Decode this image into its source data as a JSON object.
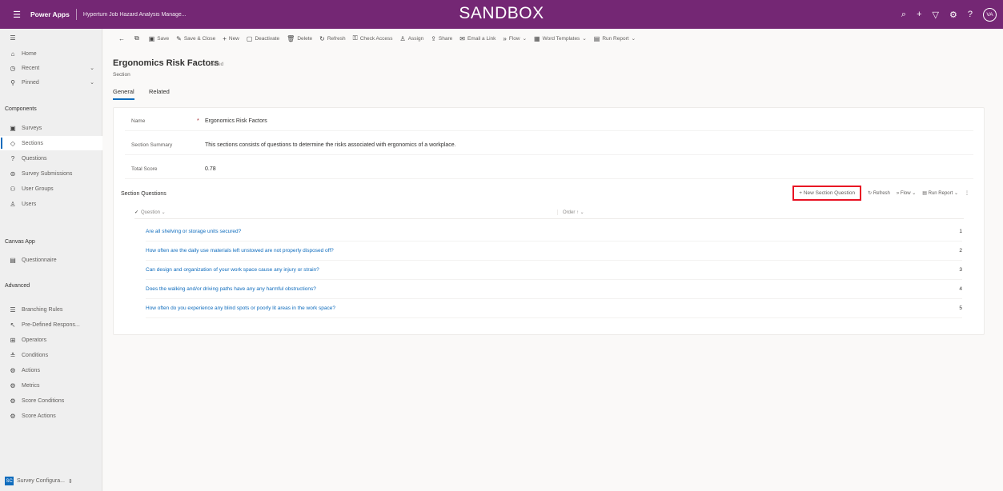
{
  "header": {
    "app_name": "Power Apps",
    "app_title": "Hypertum Job Hazard Analysis Manage...",
    "env_banner": "SANDBOX",
    "avatar_initials": "VA"
  },
  "sidebar": {
    "items_top": [
      {
        "label": "Home",
        "icon": "home-icon"
      },
      {
        "label": "Recent",
        "icon": "clock-icon"
      },
      {
        "label": "Pinned",
        "icon": "pin-icon"
      }
    ],
    "group_components": "Components",
    "items_components": [
      {
        "label": "Surveys",
        "icon": "survey-icon"
      },
      {
        "label": "Sections",
        "icon": "section-icon"
      },
      {
        "label": "Questions",
        "icon": "question-icon"
      },
      {
        "label": "Survey Submissions",
        "icon": "submission-icon"
      },
      {
        "label": "User Groups",
        "icon": "group-icon"
      },
      {
        "label": "Users",
        "icon": "user-icon"
      }
    ],
    "group_canvas": "Canvas App",
    "items_canvas": [
      {
        "label": "Questionnaire",
        "icon": "doc-icon"
      }
    ],
    "group_advanced": "Advanced",
    "items_advanced": [
      {
        "label": "Branching Rules",
        "icon": "rules-icon"
      },
      {
        "label": "Pre-Defined Respons...",
        "icon": "predefined-icon"
      },
      {
        "label": "Operators",
        "icon": "operator-icon"
      },
      {
        "label": "Conditions",
        "icon": "condition-icon"
      },
      {
        "label": "Actions",
        "icon": "action-icon"
      },
      {
        "label": "Metrics",
        "icon": "metric-icon"
      },
      {
        "label": "Score Conditions",
        "icon": "score-condition-icon"
      },
      {
        "label": "Score Actions",
        "icon": "score-action-icon"
      }
    ],
    "footer_area": "Survey Configura...",
    "footer_badge": "SC"
  },
  "commandbar": {
    "save": "Save",
    "save_close": "Save & Close",
    "new": "New",
    "deactivate": "Deactivate",
    "delete": "Delete",
    "refresh": "Refresh",
    "check_access": "Check Access",
    "assign": "Assign",
    "share": "Share",
    "email_link": "Email a Link",
    "flow": "Flow",
    "word_templates": "Word Templates",
    "run_report": "Run Report"
  },
  "record": {
    "title": "Ergonomics Risk Factors",
    "saved": "- Saved",
    "entity": "Section"
  },
  "tabs": [
    "General",
    "Related"
  ],
  "form": {
    "name_label": "Name",
    "name_value": "Ergonomics Risk Factors",
    "summary_label": "Section Summary",
    "summary_value": "This sections consists of questions to determine the risks associated with ergonomics of a workplace.",
    "score_label": "Total Score",
    "score_value": "0.78"
  },
  "subgrid": {
    "title": "Section Questions",
    "new_button": "New Section Question",
    "refresh": "Refresh",
    "flow": "Flow",
    "run_report": "Run Report",
    "col_question": "Question",
    "col_order": "Order",
    "rows": [
      {
        "question": "Are all shelving or storage units secured?",
        "order": "1"
      },
      {
        "question": "How often are the daily use materials left unstowed are not properly disposed off?",
        "order": "2"
      },
      {
        "question": "Can design and organization of your work space cause any injury or strain?",
        "order": "3"
      },
      {
        "question": "Does the walking and/or driving paths have any any harmful obstructions?",
        "order": "4"
      },
      {
        "question": "How often do you experience any blind spots or poorly lit areas in the work space?",
        "order": "5"
      }
    ]
  },
  "colors": {
    "brand": "#742774",
    "accent": "#0f6cbd",
    "highlight": "#e81123"
  }
}
